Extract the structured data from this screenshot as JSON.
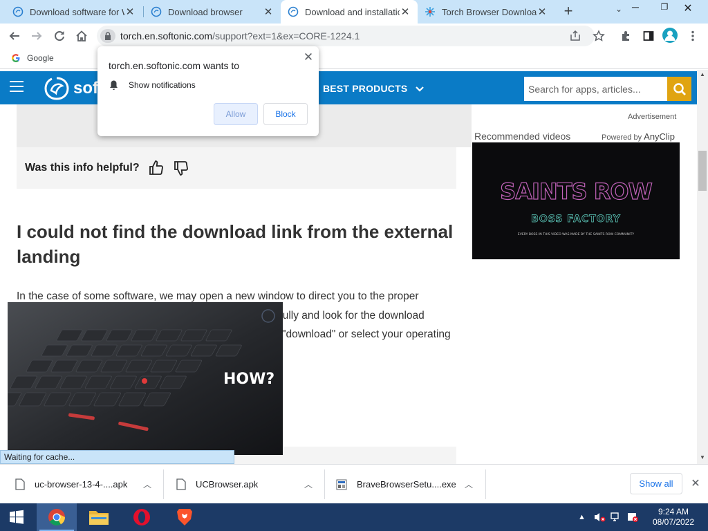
{
  "tabs": [
    {
      "title": "Download software for W",
      "active": false
    },
    {
      "title": "Download browser",
      "active": false
    },
    {
      "title": "Download and installatio",
      "active": true
    },
    {
      "title": "Torch Browser Download",
      "active": false
    }
  ],
  "address_bar": {
    "host": "torch.en.softonic.com",
    "path": "/support?ext=1&ex=CORE-1224.1"
  },
  "bookmarks": [
    {
      "label": "Google"
    }
  ],
  "site_nav": {
    "logo_text": "soft",
    "best_products": "BEST PRODUCTS",
    "search_placeholder": "Search for apps, articles..."
  },
  "article": {
    "helpful_question": "Was this info helpful?",
    "heading": "I could not find the download link from the external landing",
    "paragraph_line1": "In the case of some software, we may open a new window to direct you to the proper",
    "paragraph_line2": "arefully and look for the download",
    "paragraph_line3": "\"download\" or select your operating"
  },
  "sidebar": {
    "ad_label": "Advertisement",
    "recommended_videos": "Recommended videos",
    "powered_by": "Powered by",
    "powered_by_brand": "AnyClip",
    "video_title_line1": "SAINTS ROW",
    "video_title_line2": "BOSS FACTORY",
    "video_caption": "EVERY BOSS IN THIS VIDEO WAS MADE BY THE SAINTS ROW COMMUNITY"
  },
  "floating_video": {
    "overlay_text": "HOW?"
  },
  "status_bar": {
    "text": "Waiting for cache..."
  },
  "permission_popup": {
    "title": "torch.en.softonic.com wants to",
    "permission": "Show notifications",
    "allow_label": "Allow",
    "block_label": "Block"
  },
  "downloads": {
    "items": [
      {
        "name": "uc-browser-13-4-....apk"
      },
      {
        "name": "UCBrowser.apk"
      },
      {
        "name": "BraveBrowserSetu....exe"
      }
    ],
    "show_all_label": "Show all"
  },
  "taskbar": {
    "apps": [
      "Start",
      "Google Chrome",
      "File Explorer",
      "Opera",
      "Brave"
    ],
    "time": "9:24 AM",
    "date": "08/07/2022"
  },
  "colors": {
    "tab_strip": "#c9e4f9",
    "site_nav": "#0a7bc6",
    "search_button": "#e0a411",
    "taskbar": "#1c3a66"
  }
}
